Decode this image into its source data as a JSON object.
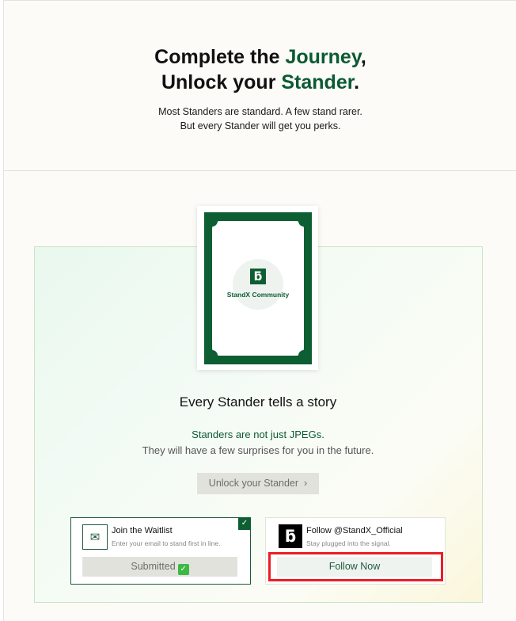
{
  "hero": {
    "title_line1_a": "Complete the ",
    "title_line1_b": "Journey",
    "title_line1_c": ",",
    "title_line2_a": "Unlock your ",
    "title_line2_b": "Stander",
    "title_line2_c": ".",
    "subtitle_line1": "Most Standers are standard. A few stand rarer.",
    "subtitle_line2": "But every Stander will get you perks."
  },
  "card": {
    "logo_glyph": "ƃ",
    "label": "StandX Community"
  },
  "story": {
    "title": "Every Stander tells a story",
    "line1": "Standers are not just JPEGs.",
    "line2": "They will have a few surprises for you in the future.",
    "unlock_label": "Unlock your Stander",
    "unlock_chevron": "›"
  },
  "waitlist": {
    "title": "Join the Waitlist",
    "subtitle": "Enter your email to stand first in line.",
    "button_label": "Submitted",
    "button_emoji": "✓",
    "check_glyph": "✓",
    "icon": "mail-icon"
  },
  "follow": {
    "title": "Follow @StandX_Official",
    "subtitle": "Stay plugged into the signal.",
    "button_label": "Follow Now",
    "logo_glyph": "ƃ"
  },
  "colors": {
    "brand_green": "#0d5e33",
    "highlight_red": "#ee1c24"
  }
}
